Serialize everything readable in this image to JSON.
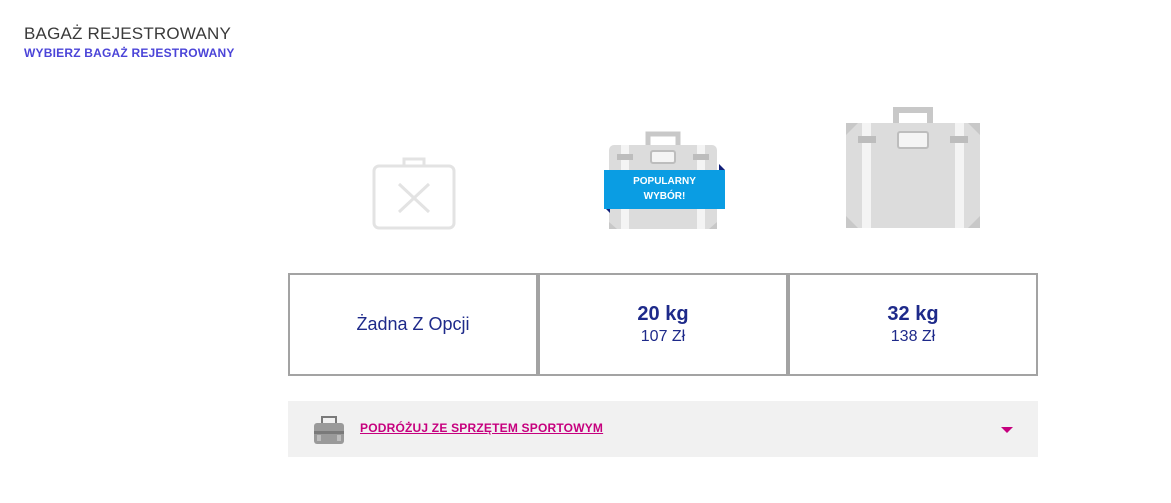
{
  "header": {
    "title": "BAGAŻ REJESTROWANY",
    "subtitle": "WYBIERZ BAGAŻ REJESTROWANY"
  },
  "icons": {
    "none": "suitcase-crossed-icon",
    "medium": "suitcase-medium-icon",
    "large": "suitcase-large-icon"
  },
  "badge": {
    "line1": "POPULARNY",
    "line2": "WYBÓR!"
  },
  "options": {
    "none": {
      "label": "Żadna Z Opcji"
    },
    "medium": {
      "weight": "20 kg",
      "price": "107 Zł"
    },
    "large": {
      "weight": "32 kg",
      "price": "138 Zł"
    }
  },
  "sports": {
    "label": "PODRÓŻUJ ZE SPRZĘTEM SPORTOWYM",
    "icon": "sports-bag-icon"
  },
  "colors": {
    "brand_blue": "#1e2a8a",
    "subtitle_violet": "#4b44d8",
    "accent_magenta": "#c6007e",
    "badge_blue": "#0a9de3",
    "border_gray": "#a3a3a3"
  }
}
